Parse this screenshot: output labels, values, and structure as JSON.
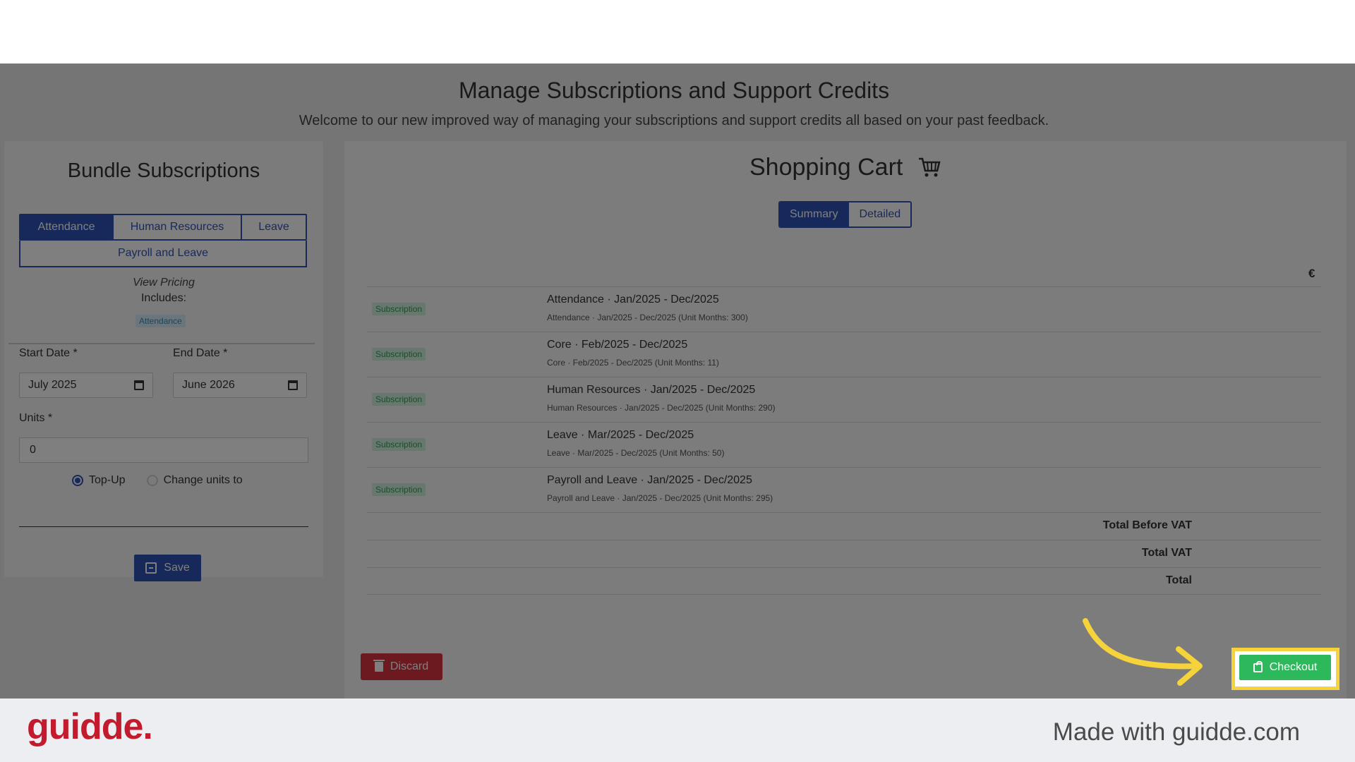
{
  "page": {
    "title": "Manage Subscriptions and Support Credits",
    "subtitle": "Welcome to our new improved way of managing your subscriptions and support credits all based on your past feedback."
  },
  "bundle": {
    "title": "Bundle Subscriptions",
    "tabs": [
      "Attendance",
      "Human Resources",
      "Leave",
      "Payroll and Leave"
    ],
    "active_tab": "Attendance",
    "view_pricing": "View Pricing",
    "includes_label": "Includes:",
    "includes_badge": "Attendance",
    "start_date_label": "Start Date *",
    "start_date_value": "July 2025",
    "end_date_label": "End Date *",
    "end_date_value": "June 2026",
    "units_label": "Units *",
    "units_value": "0",
    "radio_topup": "Top-Up",
    "radio_change": "Change units to",
    "selected_radio": "Top-Up",
    "save_label": "Save"
  },
  "cart": {
    "title": "Shopping Cart",
    "view_summary": "Summary",
    "view_detailed": "Detailed",
    "active_view": "Summary",
    "currency": "€",
    "rows": [
      {
        "badge": "Subscription",
        "title": "Attendance · Jan/2025 - Dec/2025",
        "detail": "Attendance · Jan/2025 - Dec/2025 (Unit Months: 300)"
      },
      {
        "badge": "Subscription",
        "title": "Core · Feb/2025 - Dec/2025",
        "detail": "Core · Feb/2025 - Dec/2025 (Unit Months: 11)"
      },
      {
        "badge": "Subscription",
        "title": "Human Resources · Jan/2025 - Dec/2025",
        "detail": "Human Resources · Jan/2025 - Dec/2025 (Unit Months: 290)"
      },
      {
        "badge": "Subscription",
        "title": "Leave · Mar/2025 - Dec/2025",
        "detail": "Leave · Mar/2025 - Dec/2025 (Unit Months: 50)"
      },
      {
        "badge": "Subscription",
        "title": "Payroll and Leave · Jan/2025 - Dec/2025",
        "detail": "Payroll and Leave · Jan/2025 - Dec/2025 (Unit Months: 295)"
      }
    ],
    "total_before_vat_label": "Total Before VAT",
    "total_vat_label": "Total VAT",
    "total_label": "Total",
    "discard_label": "Discard",
    "checkout_label": "Checkout"
  },
  "footer": {
    "logo": "guidde.",
    "made_with": "Made with guidde.com"
  },
  "colors": {
    "primary": "#2f52b4",
    "success": "#2eb85c",
    "danger": "#d9333f",
    "highlight": "#f6d33a",
    "logo_red": "#c41a2e"
  }
}
